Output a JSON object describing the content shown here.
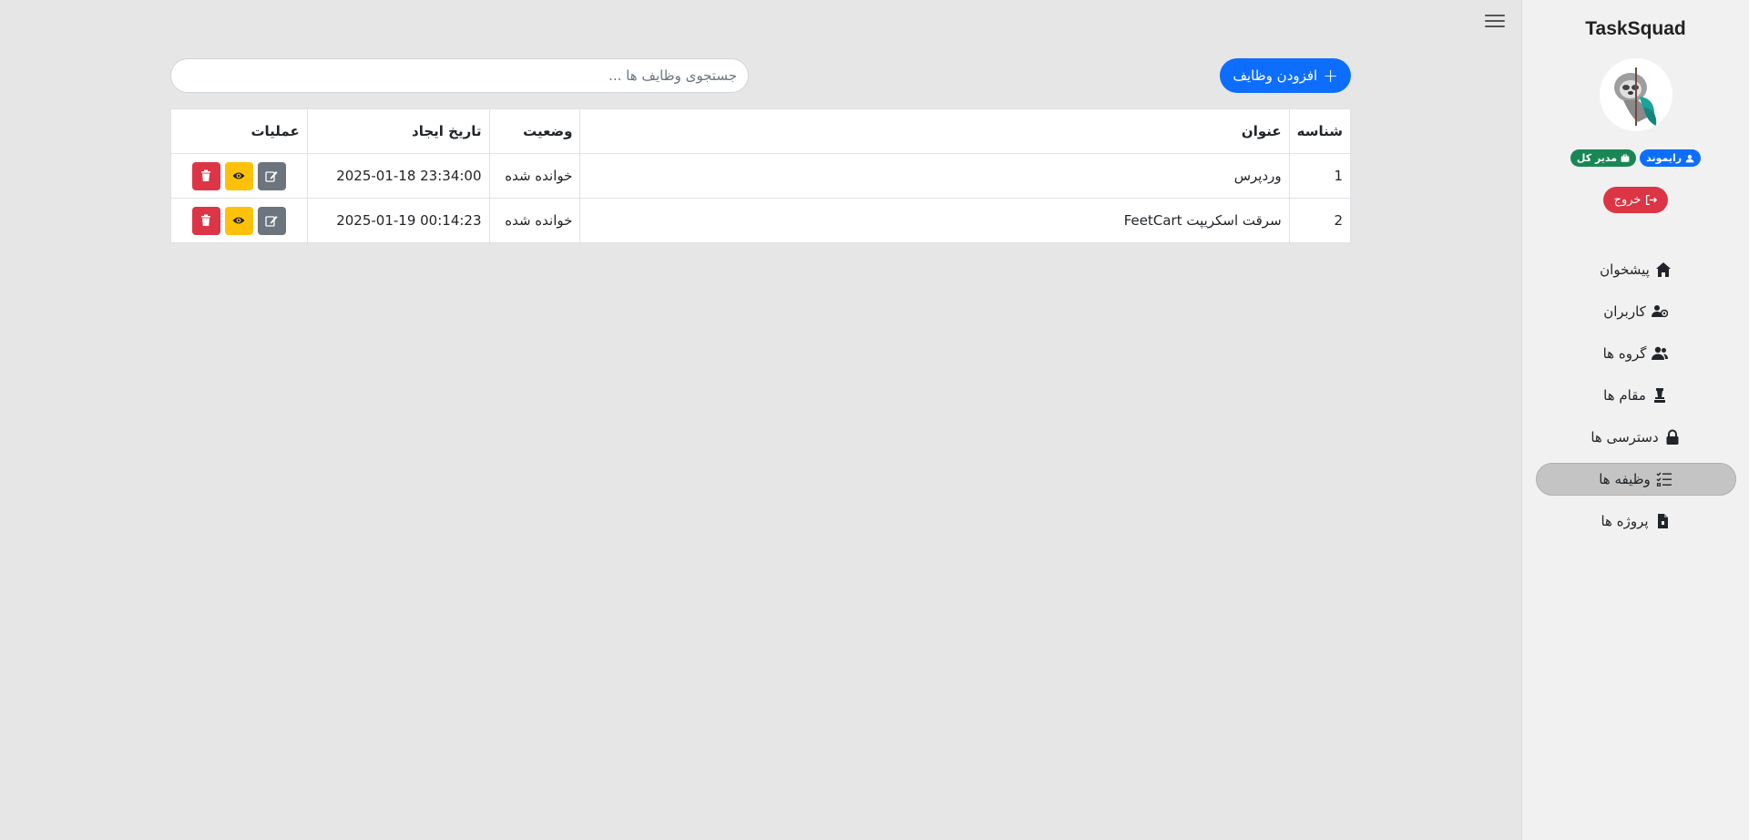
{
  "app": {
    "brand": "TaskSquad"
  },
  "user": {
    "name": "رایموند",
    "role": "مدیر کل"
  },
  "sidebar": {
    "logout_label": "خروج",
    "items": [
      {
        "label": "پیشخوان",
        "icon": "home-icon",
        "active": false
      },
      {
        "label": "کاربران",
        "icon": "users-gear-icon",
        "active": false
      },
      {
        "label": "گروه ها",
        "icon": "user-group-icon",
        "active": false
      },
      {
        "label": "مقام ها",
        "icon": "chess-icon",
        "active": false
      },
      {
        "label": "دسترسی ها",
        "icon": "lock-icon",
        "active": false
      },
      {
        "label": "وظیفه ها",
        "icon": "task-list-icon",
        "active": true
      },
      {
        "label": "پروژه ها",
        "icon": "file-icon",
        "active": false
      }
    ]
  },
  "toolbar": {
    "add_label": "افزودن وظایف",
    "search_placeholder": "جستجوی وظایف ها ..."
  },
  "table": {
    "headers": {
      "id": "شناسه",
      "title": "عنوان",
      "status": "وضعیت",
      "date": "تاریخ ایجاد",
      "ops": "عملیات"
    },
    "rows": [
      {
        "id": "1",
        "title": "وردپرس",
        "status": "خوانده شده",
        "date": "2025-01-18 23:34:00"
      },
      {
        "id": "2",
        "title": "سرقت اسکریپت FeetCart",
        "status": "خوانده شده",
        "date": "2025-01-19 00:14:23"
      }
    ]
  },
  "colors": {
    "primary": "#0d6efd",
    "danger": "#dc3545",
    "warning": "#ffc107",
    "secondary": "#6c757d",
    "success": "#198754"
  }
}
